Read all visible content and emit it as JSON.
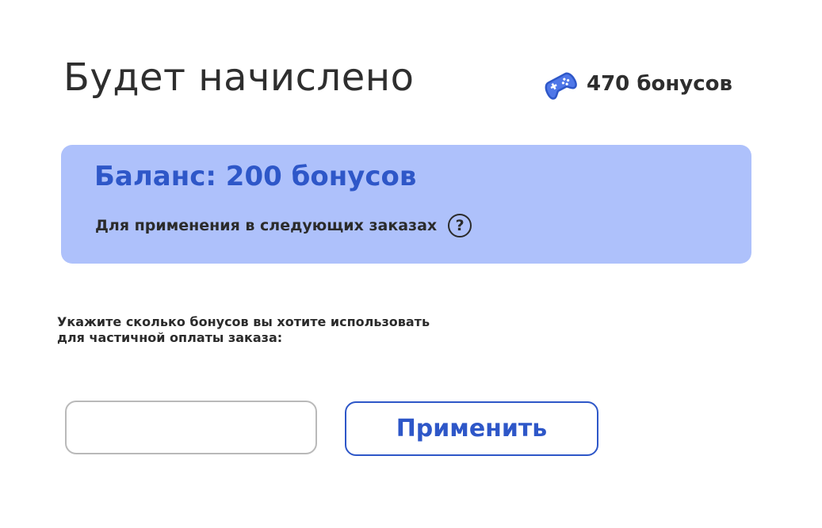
{
  "header": {
    "title": "Будет начислено",
    "accrual_icon": "gamepad-icon",
    "accrual_value": "470 бонусов"
  },
  "balance_card": {
    "title": "Баланс: 200 бонусов",
    "note": "Для применения в следующих заказах",
    "help_icon": "question-circle-icon",
    "help_symbol": "?"
  },
  "instruction": {
    "line1": "Укажите сколько бонусов вы хотите использовать",
    "line2": "для частичной оплаты заказа:"
  },
  "bonus_input": {
    "value": "",
    "placeholder": ""
  },
  "apply_button": {
    "label": "Применить"
  },
  "colors": {
    "accent": "#2e57c8",
    "card_background": "#aec1fb",
    "text": "#2b2b2b",
    "input_border": "#b9b9b9"
  }
}
